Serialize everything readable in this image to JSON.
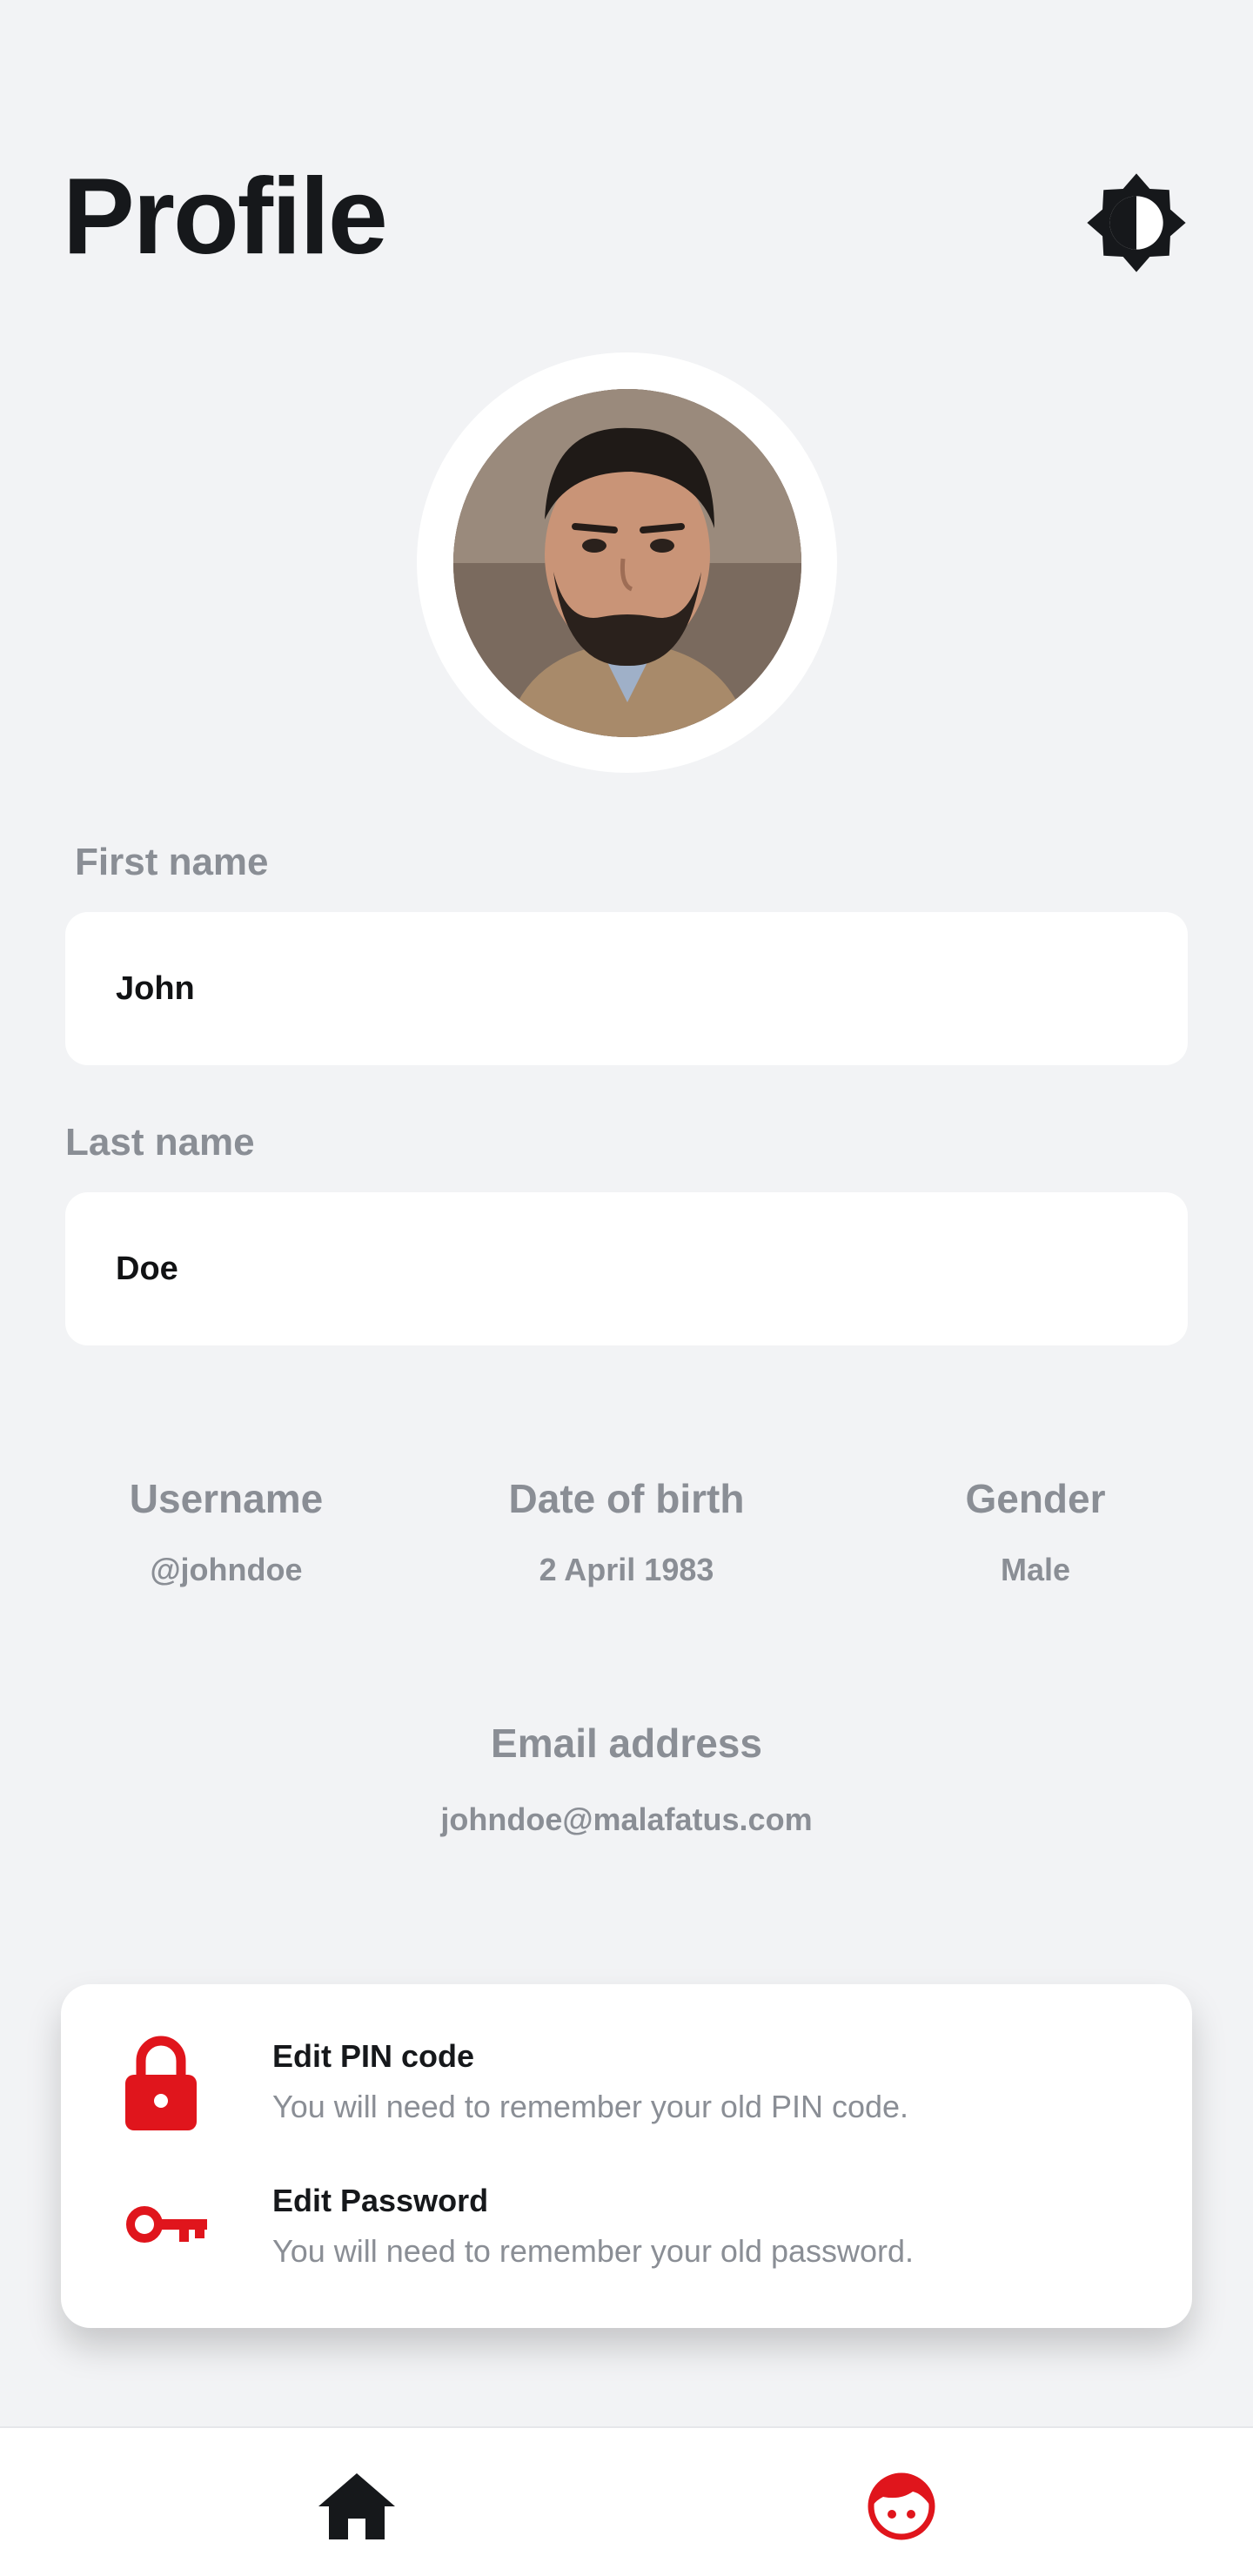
{
  "header": {
    "title": "Profile",
    "theme_icon": "brightness-contrast-icon"
  },
  "avatar": {
    "alt": "John Doe"
  },
  "form": {
    "first_name_label": "First name",
    "first_name_value": "John",
    "last_name_label": "Last name",
    "last_name_value": "Doe"
  },
  "info": {
    "username_label": "Username",
    "username_value": "@johndoe",
    "dob_label": "Date of birth",
    "dob_value": "2 April 1983",
    "gender_label": "Gender",
    "gender_value": "Male",
    "email_label": "Email address",
    "email_value": "johndoe@malafatus.com"
  },
  "security": {
    "items": [
      {
        "icon": "lock-icon",
        "title": "Edit PIN code",
        "subtitle": "You will need to remember your old PIN code."
      },
      {
        "icon": "key-icon",
        "title": "Edit Password",
        "subtitle": "You will need to remember your old password."
      }
    ]
  },
  "nav": {
    "home_icon": "home-icon",
    "profile_icon": "profile-face-icon"
  },
  "colors": {
    "accent": "#e0151c",
    "text_dark": "#16181b",
    "text_muted": "#8a8e95",
    "background": "#f2f3f5"
  }
}
